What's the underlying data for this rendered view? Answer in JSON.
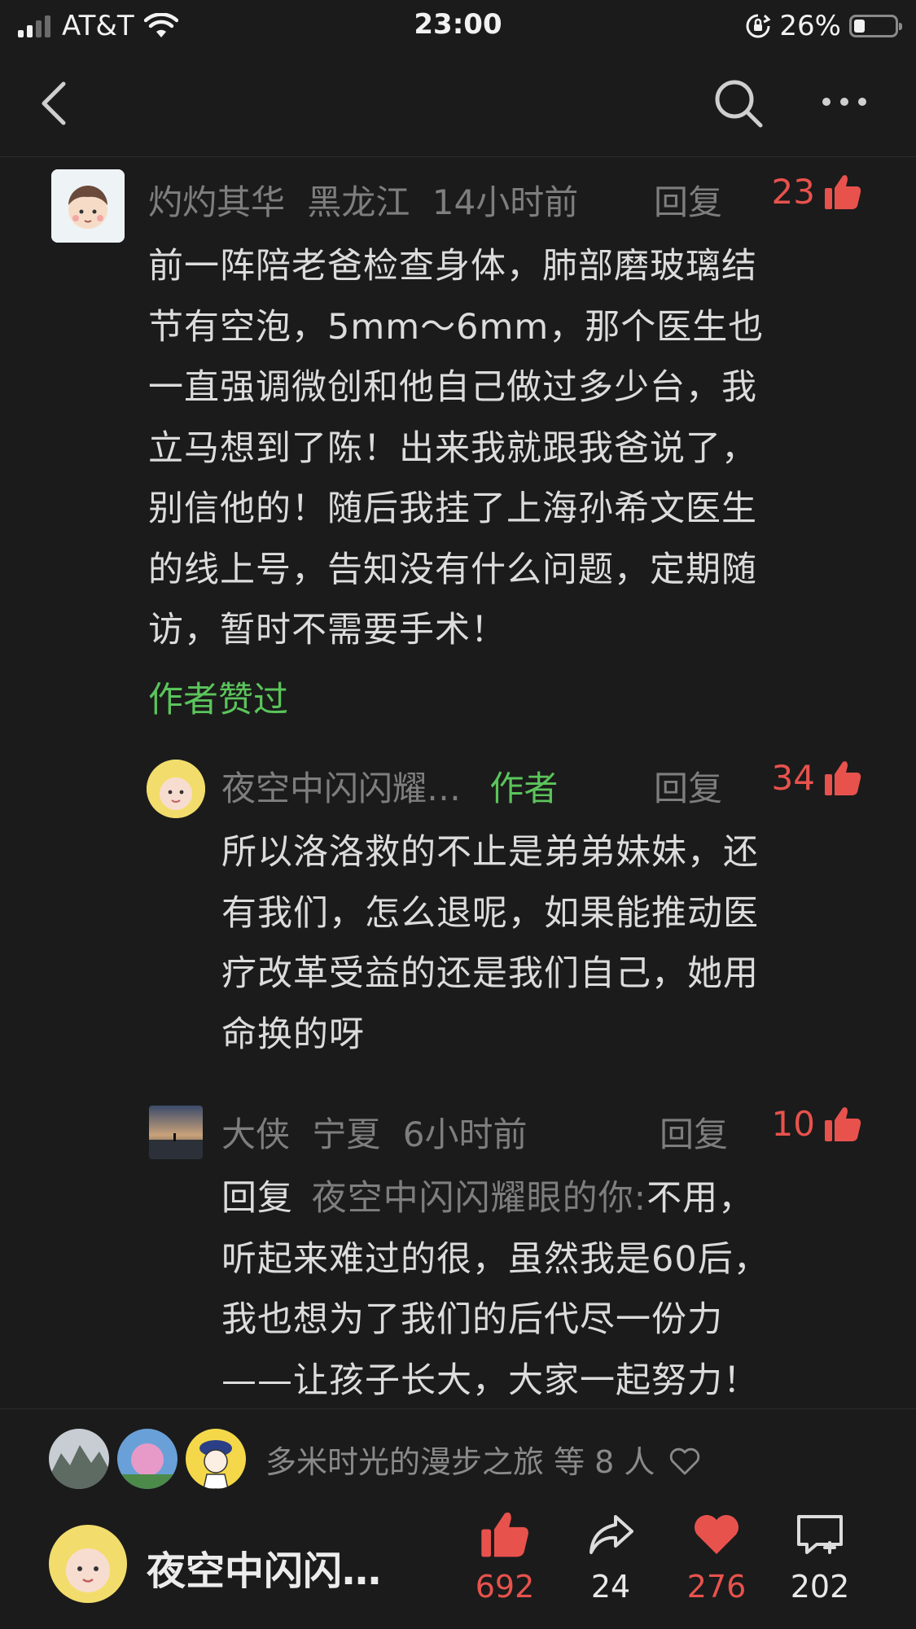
{
  "status_bar": {
    "carrier": "AT&T",
    "time": "23:00",
    "battery": "26%",
    "battery_level": 0.26
  },
  "nav": {
    "back_icon": "chevron-left-icon",
    "search_icon": "search-icon",
    "more_icon": "more-horizontal-icon"
  },
  "comments": [
    {
      "user": "灼灼其华",
      "location": "黑龙江",
      "time": "14小时前",
      "reply_label": "回复",
      "likes": "23",
      "lines": [
        "前一阵陪老爸检查身体，肺部磨玻璃结",
        "节有空泡，5mm～6mm，那个医生也",
        "一直强调微创和他自己做过多少台，我",
        "立马想到了陈！出来我就跟我爸说了，",
        "别信他的！随后我挂了上海孙希文医生",
        "的线上号，告知没有什么问题，定期随",
        "访，暂时不需要手术！"
      ],
      "author_liked": "作者赞过"
    },
    {
      "user": "夜空中闪闪耀…",
      "badge": "作者",
      "reply_label": "回复",
      "likes": "34",
      "lines": [
        "所以洛洛救的不止是弟弟妹妹，还",
        "有我们，怎么退呢，如果能推动医",
        "疗改革受益的还是我们自己，她用",
        "命换的呀"
      ]
    },
    {
      "user": "大侠",
      "location": "宁夏",
      "time": "6小时前",
      "reply_label": "回复",
      "likes": "10",
      "reply_prefix": "回复",
      "reply_to": "夜空中闪闪耀眼的你:",
      "first_line_rest": "不用，",
      "lines": [
        "听起来难过的很，虽然我是60后，",
        "我也想为了我们的后代尽一份力",
        "——让孩子长大，大家一起努力！"
      ]
    }
  ],
  "bottom": {
    "likers_text": "多米时光的漫步之旅 等 8 人",
    "heart_outline_icon": "heart-outline-icon",
    "author_name": "夜空中闪闪…",
    "actions": [
      {
        "name": "like",
        "icon": "thumbs-up-icon",
        "count": "692",
        "color": "#e8524d"
      },
      {
        "name": "share",
        "icon": "share-icon",
        "count": "24",
        "color": "#dcdcdc"
      },
      {
        "name": "favorite",
        "icon": "heart-icon",
        "count": "276",
        "color": "#e8524d"
      },
      {
        "name": "comment",
        "icon": "comment-plus-icon",
        "count": "202",
        "color": "#dcdcdc"
      }
    ]
  }
}
